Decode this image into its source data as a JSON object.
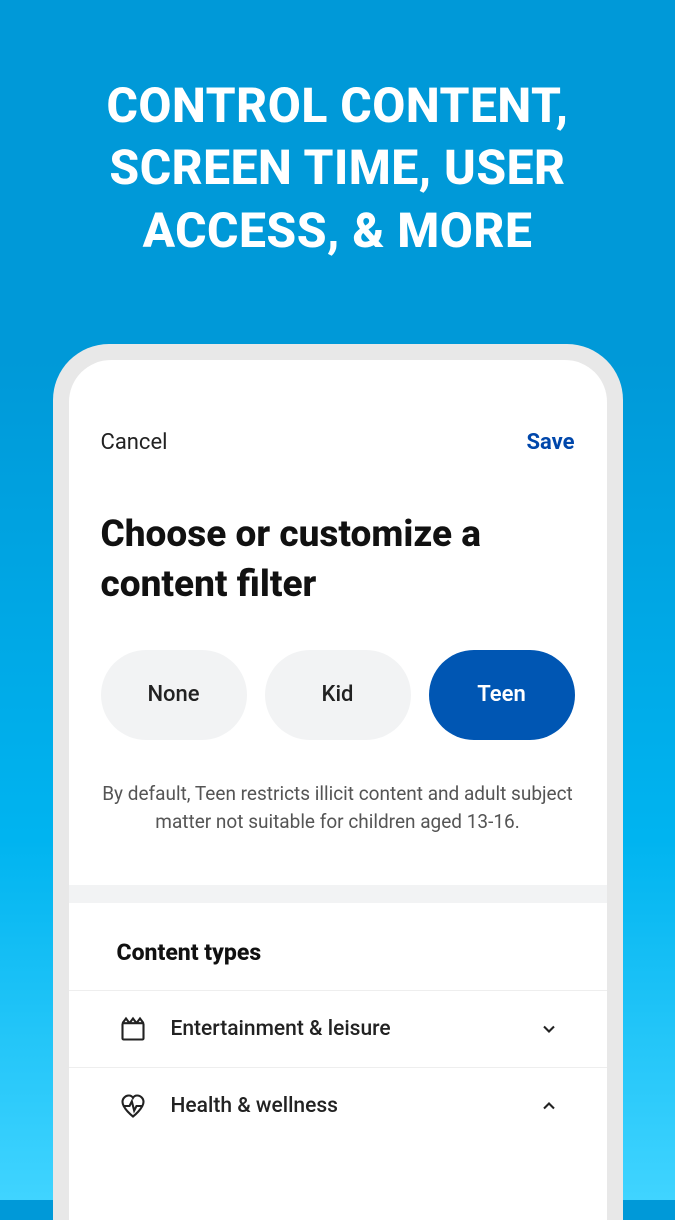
{
  "promo": {
    "heading": "CONTROL CONTENT, SCREEN TIME, USER ACCESS, & MORE"
  },
  "header": {
    "cancel_label": "Cancel",
    "save_label": "Save"
  },
  "page": {
    "title": "Choose or customize a content filter"
  },
  "filters": {
    "options": [
      {
        "label": "None",
        "active": false
      },
      {
        "label": "Kid",
        "active": false
      },
      {
        "label": "Teen",
        "active": true
      }
    ],
    "description": "By default, Teen restricts illicit content and adult subject matter not suitable for children aged 13-16."
  },
  "content_types": {
    "heading": "Content types",
    "items": [
      {
        "label": "Entertainment & leisure",
        "icon": "clapperboard",
        "expanded": false
      },
      {
        "label": "Health & wellness",
        "icon": "heartbeat",
        "expanded": true
      }
    ]
  }
}
